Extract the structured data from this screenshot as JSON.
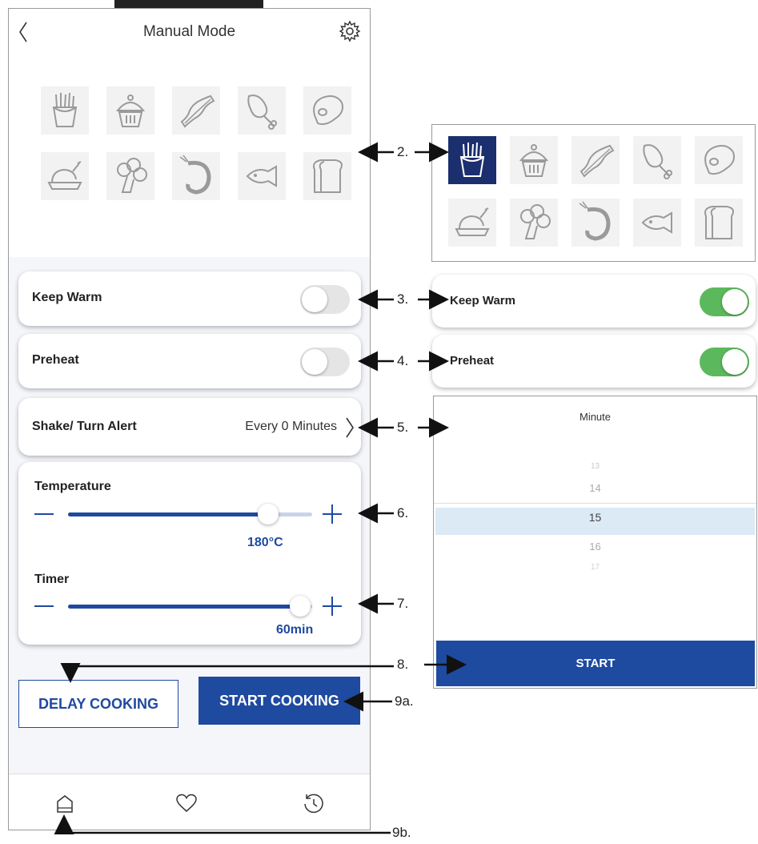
{
  "header": {
    "title": "Manual Mode"
  },
  "food_presets": [
    "fries-icon",
    "cupcake-icon",
    "bacon-icon",
    "chicken-leg-icon",
    "steak-icon",
    "roast-chicken-icon",
    "broccoli-icon",
    "shrimp-icon",
    "fish-icon",
    "bread-icon"
  ],
  "settings": {
    "keep_warm": {
      "label": "Keep Warm",
      "on": false
    },
    "preheat": {
      "label": "Preheat",
      "on": false
    },
    "shake_alert": {
      "label": "Shake/ Turn Alert",
      "value": "Every 0 Minutes"
    }
  },
  "temperature": {
    "label": "Temperature",
    "value": "180°C",
    "level": 0.82
  },
  "timer": {
    "label": "Timer",
    "value": "60min",
    "level": 0.95
  },
  "buttons": {
    "delay": "DELAY COOKING",
    "start": "START COOKING"
  },
  "nav": [
    "home-icon",
    "heart-icon",
    "history-icon"
  ],
  "callouts": {
    "c2": "2.",
    "c3": "3.",
    "c4": "4.",
    "c5": "5.",
    "c6": "6.",
    "c7": "7.",
    "c8": "8.",
    "c9a": "9a.",
    "c9b": "9b."
  },
  "detail": {
    "keep_warm": {
      "label": "Keep Warm",
      "on": true
    },
    "preheat": {
      "label": "Preheat",
      "on": true
    },
    "picker": {
      "title": "Minute",
      "items": [
        "13",
        "14",
        "15",
        "16",
        "17"
      ],
      "selected": "15",
      "button": "START"
    }
  },
  "colors": {
    "accent": "#1e4aa0",
    "selected_tile": "#1b2f6e",
    "toggle_on": "#5cb85c"
  }
}
